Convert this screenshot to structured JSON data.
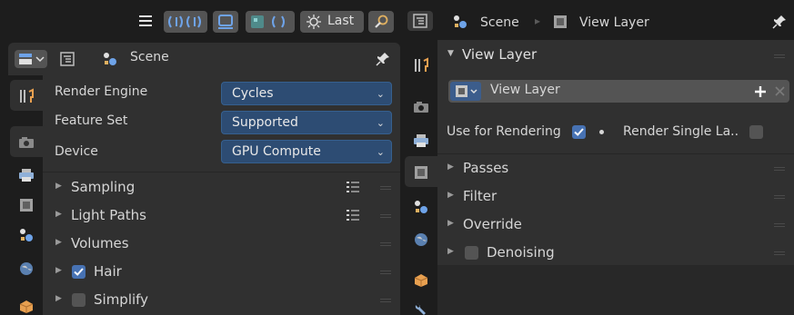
{
  "left_editor": {
    "topbar": {
      "last_label": "Last"
    },
    "header": {
      "scene_label": "Scene"
    },
    "properties": [
      {
        "label": "Render Engine",
        "value": "Cycles"
      },
      {
        "label": "Feature Set",
        "value": "Supported"
      },
      {
        "label": "Device",
        "value": "GPU Compute"
      }
    ],
    "sections": [
      {
        "label": "Sampling"
      },
      {
        "label": "Light Paths"
      },
      {
        "label": "Volumes"
      },
      {
        "label": "Hair"
      },
      {
        "label": "Simplify"
      }
    ]
  },
  "right_editor": {
    "breadcrumb": {
      "scene": "Scene",
      "view_layer": "View Layer"
    },
    "panel_title": "View Layer",
    "view_layer_field": "View Layer",
    "use_for_rendering_label": "Use for Rendering",
    "render_single_label": "Render Single La..",
    "sections": [
      {
        "label": "Passes"
      },
      {
        "label": "Filter"
      },
      {
        "label": "Override"
      },
      {
        "label": "Denoising"
      }
    ]
  },
  "colors": {
    "accent": "#4772b3",
    "dropdown_bg": "#2d4c73",
    "panel_bg": "#303030",
    "window_bg": "#1d1d1d"
  }
}
